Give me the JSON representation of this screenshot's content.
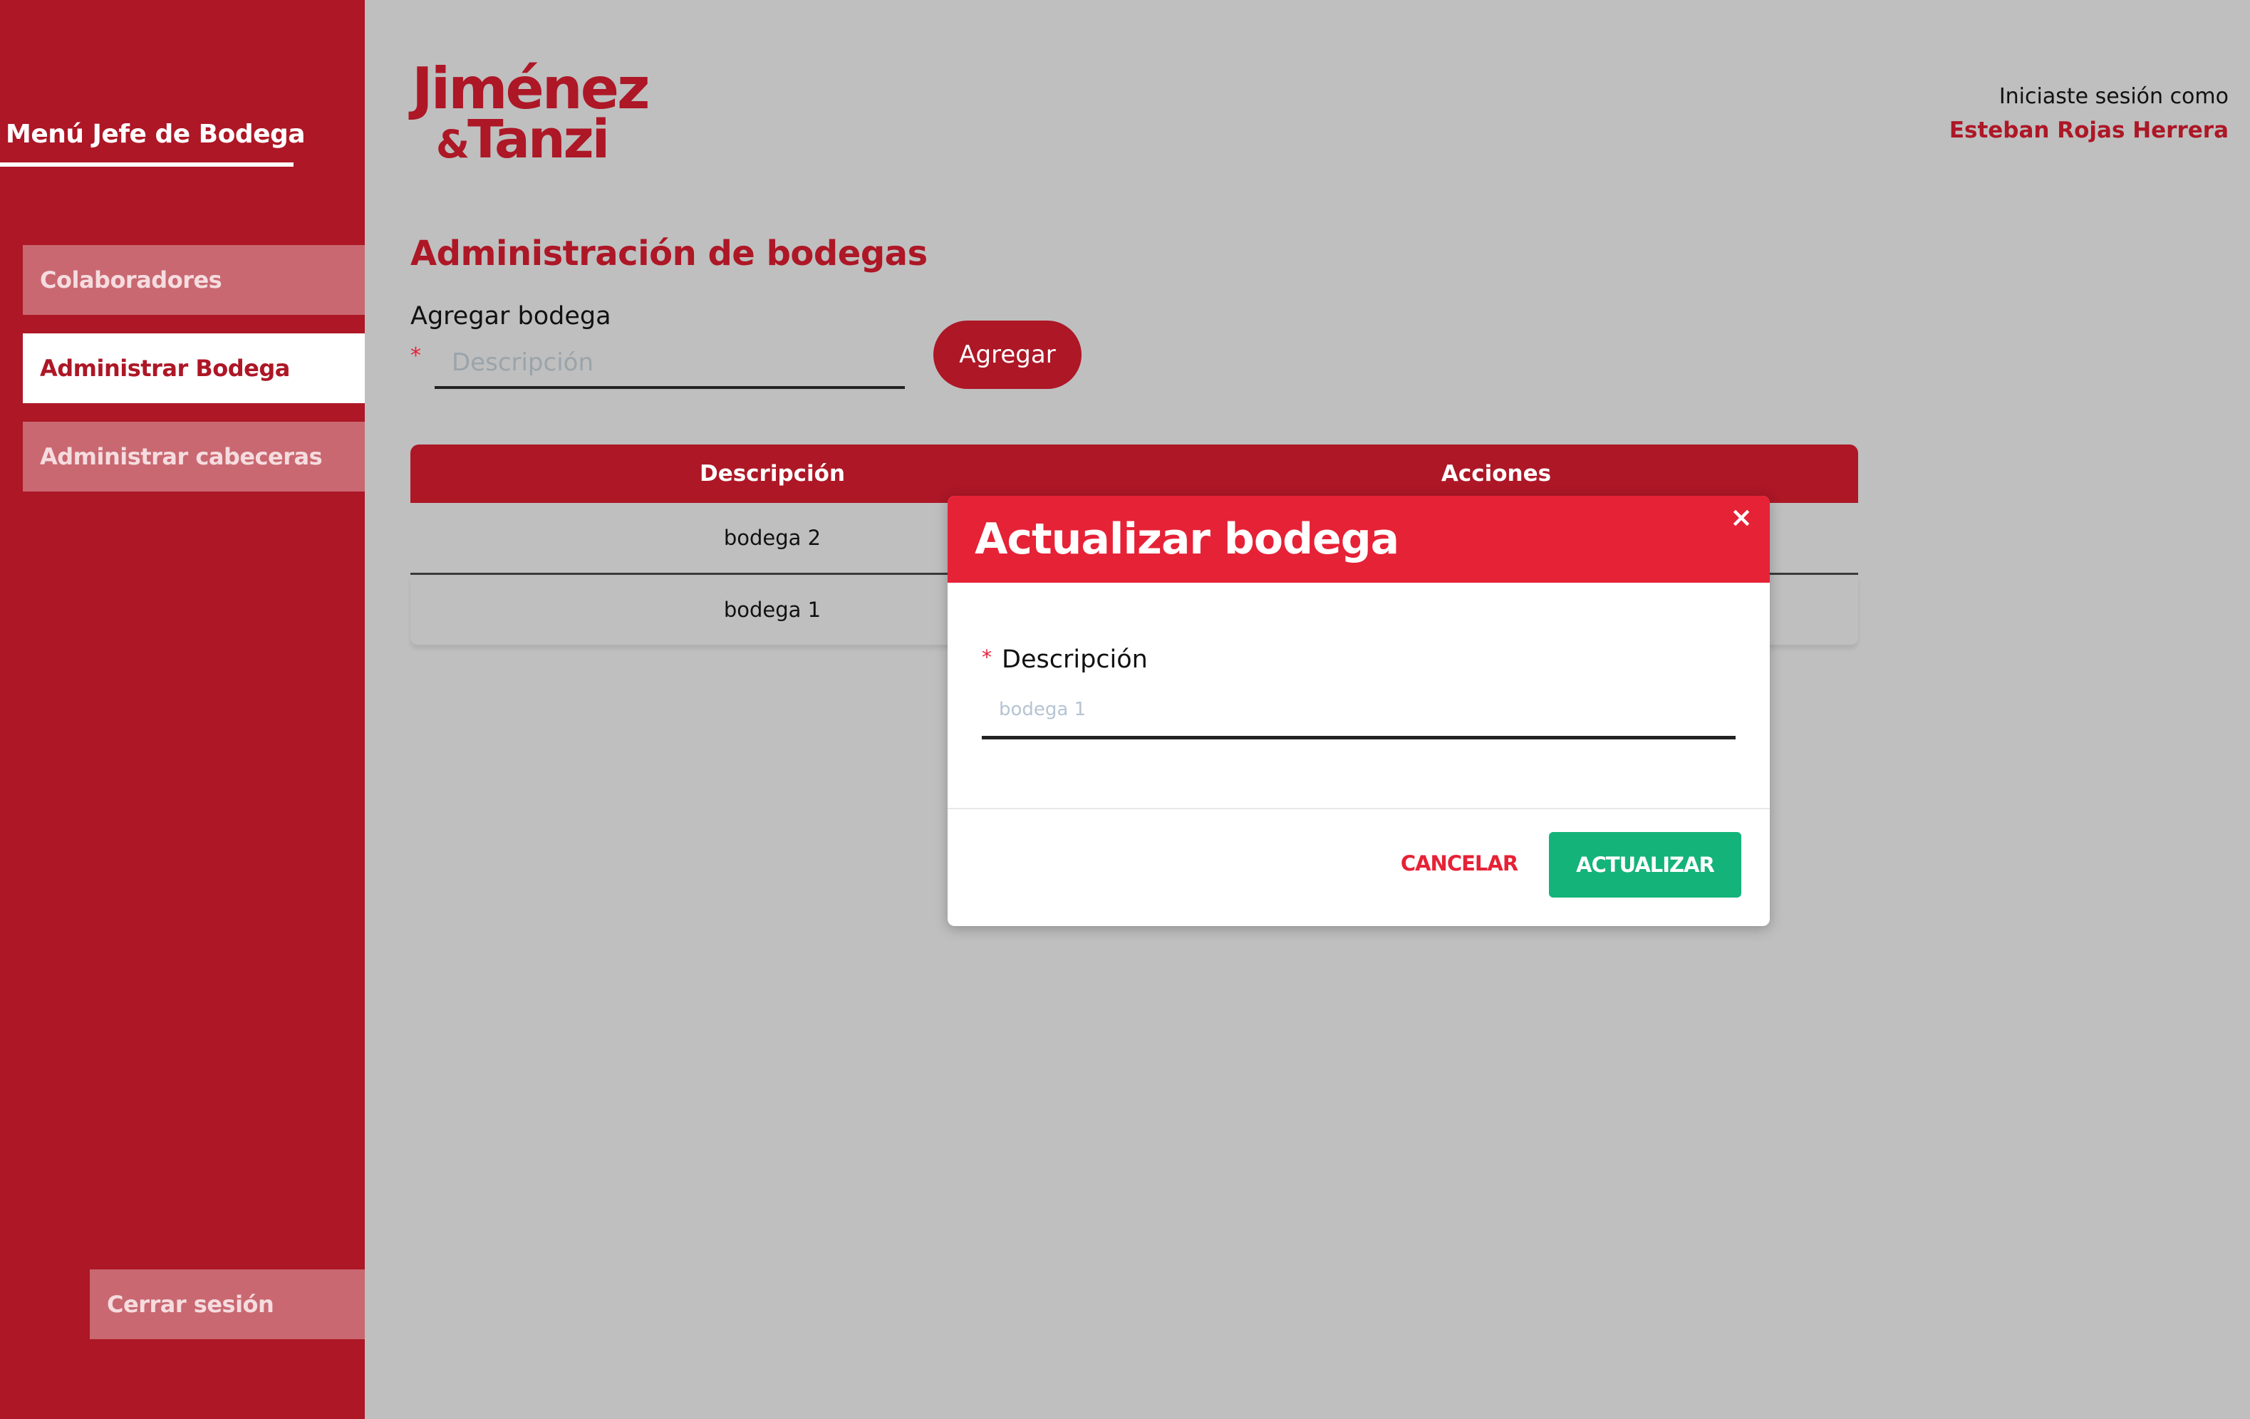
{
  "sidebar": {
    "title": "Menú Jefe de Bodega",
    "items": [
      {
        "label": "Colaboradores"
      },
      {
        "label": "Administrar Bodega"
      },
      {
        "label": "Administrar cabeceras"
      }
    ],
    "logout_label": "Cerrar sesión"
  },
  "logo": {
    "line1": "Jiménez",
    "amp": "&",
    "line2": "Tanzi"
  },
  "session": {
    "label": "Iniciaste sesión como",
    "user": "Esteban Rojas Herrera"
  },
  "page": {
    "title": "Administración de bodegas",
    "add_label": "Agregar bodega",
    "required_mark": "*",
    "add_placeholder": "Descripción",
    "add_button": "Agregar"
  },
  "table": {
    "columns": [
      "Descripción",
      "Acciones"
    ],
    "rows": [
      {
        "descripcion": "bodega 2"
      },
      {
        "descripcion": "bodega 1"
      }
    ]
  },
  "modal": {
    "title": "Actualizar bodega",
    "close_symbol": "×",
    "required_mark": "*",
    "field_label": "Descripción",
    "field_placeholder": "bodega 1",
    "cancel_label": "CANCELAR",
    "update_label": "ACTUALIZAR"
  },
  "colors": {
    "brand": "#ad1726",
    "modal_header": "#e62236",
    "update_button": "#14b37a",
    "overlay_background": "#bfbfbf"
  }
}
